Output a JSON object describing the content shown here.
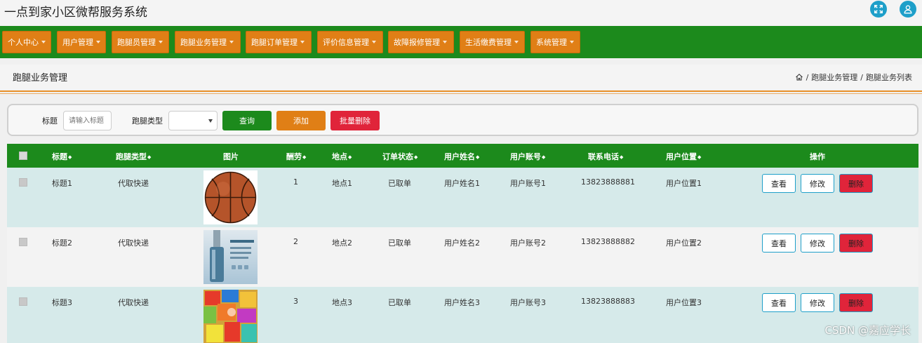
{
  "app_title": "一点到家小区微帮服务系统",
  "nav": [
    {
      "label": "个人中心"
    },
    {
      "label": "用户管理"
    },
    {
      "label": "跑腿员管理"
    },
    {
      "label": "跑腿业务管理"
    },
    {
      "label": "跑腿订单管理"
    },
    {
      "label": "评价信息管理"
    },
    {
      "label": "故障报修管理"
    },
    {
      "label": "生活缴费管理"
    },
    {
      "label": "系统管理"
    }
  ],
  "page_title": "跑腿业务管理",
  "breadcrumb": {
    "level1": "跑腿业务管理",
    "level2": "跑腿业务列表"
  },
  "search": {
    "title_label": "标题",
    "title_placeholder": "请输入标题",
    "type_label": "跑腿类型",
    "type_value": "",
    "search_button": "查询",
    "add_button": "添加",
    "batch_delete_button": "批量删除"
  },
  "table": {
    "headers": {
      "title": "标题",
      "type": "跑腿类型",
      "image": "图片",
      "fee": "酬劳",
      "location": "地点",
      "status": "订单状态",
      "user_name": "用户姓名",
      "user_account": "用户账号",
      "phone": "联系电话",
      "user_location": "用户位置",
      "actions": "操作"
    },
    "rows": [
      {
        "title": "标题1",
        "type": "代取快递",
        "image": "basketball",
        "fee": "1",
        "location": "地点1",
        "status": "已取单",
        "user_name": "用户姓名1",
        "user_account": "用户账号1",
        "phone": "13823888881",
        "user_location": "用户位置1"
      },
      {
        "title": "标题2",
        "type": "代取快递",
        "image": "cosmetic-bottle",
        "fee": "2",
        "location": "地点2",
        "status": "已取单",
        "user_name": "用户姓名2",
        "user_account": "用户账号2",
        "phone": "13823888882",
        "user_location": "用户位置2"
      },
      {
        "title": "标题3",
        "type": "代取快递",
        "image": "snacks",
        "fee": "3",
        "location": "地点3",
        "status": "已取单",
        "user_name": "用户姓名3",
        "user_account": "用户账号3",
        "phone": "13823888883",
        "user_location": "用户位置3"
      }
    ],
    "action_labels": {
      "view": "查看",
      "edit": "修改",
      "delete": "删除"
    }
  },
  "watermark": "CSDN @嘉应学长",
  "colors": {
    "green": "#1c8a1c",
    "orange": "#e07f16",
    "red": "#e0243a",
    "blue": "#1e9fc9",
    "row_tint": "#d6eaea"
  }
}
